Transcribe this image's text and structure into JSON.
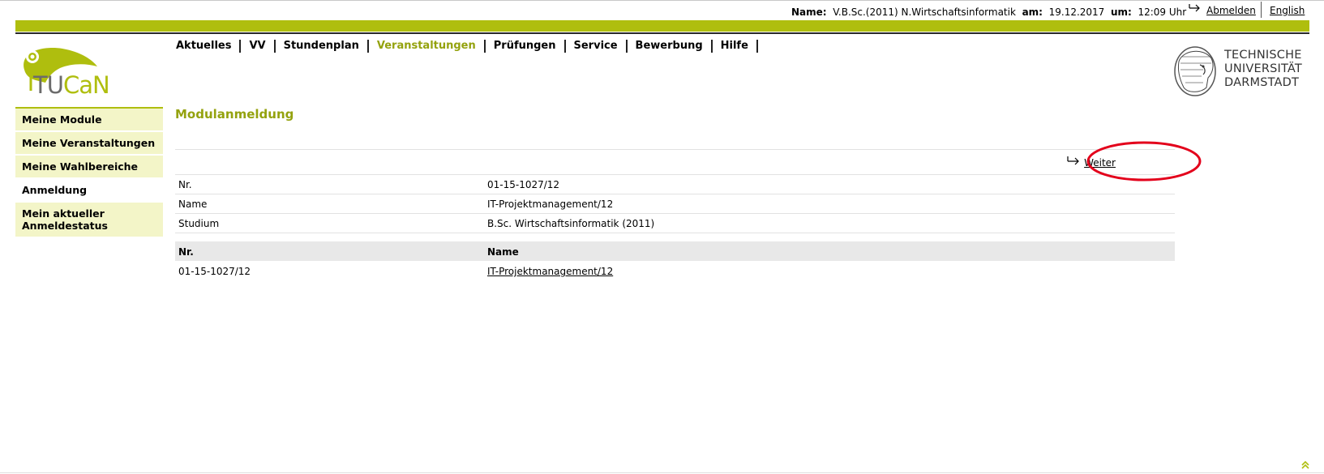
{
  "userbar": {
    "name_label": "Name:",
    "name_value": "V.B.Sc.(2011) N.Wirtschaftsinformatik",
    "date_label": "am:",
    "date_value": "19.12.2017",
    "time_label": "um:",
    "time_value": "12:09 Uhr",
    "logout_label": "Abmelden",
    "language_label": "English"
  },
  "logo": {
    "tu": "TU",
    "can": "CaN"
  },
  "nav": {
    "items": [
      {
        "label": "Aktuelles"
      },
      {
        "label": "VV"
      },
      {
        "label": "Stundenplan"
      },
      {
        "label": "Veranstaltungen"
      },
      {
        "label": "Prüfungen"
      },
      {
        "label": "Service"
      },
      {
        "label": "Bewerbung"
      },
      {
        "label": "Hilfe"
      }
    ],
    "active": "Veranstaltungen"
  },
  "university": {
    "line1": "TECHNISCHE",
    "line2": "UNIVERSITÄT",
    "line3": "DARMSTADT"
  },
  "sidebar": {
    "items": [
      {
        "label": "Meine Module"
      },
      {
        "label": "Meine Veranstaltungen"
      },
      {
        "label": "Meine Wahlbereiche"
      },
      {
        "label": "Anmeldung"
      },
      {
        "label": "Mein aktueller Anmeldestatus"
      }
    ]
  },
  "page": {
    "title": "Modulanmeldung",
    "next_label": "Weiter"
  },
  "details": [
    {
      "label": "Nr.",
      "value": "01-15-1027/12"
    },
    {
      "label": "Name",
      "value": "IT-Projektmanagement/12"
    },
    {
      "label": "Studium",
      "value": "B.Sc. Wirtschaftsinformatik (2011)"
    }
  ],
  "table": {
    "headers": [
      "Nr.",
      "Name"
    ],
    "rows": [
      [
        "01-15-1027/12",
        "IT-Projektmanagement/12"
      ]
    ]
  },
  "colors": {
    "accent": "#afbe0e",
    "accent_text": "#94a20e",
    "highlight_ring": "#e3001b",
    "sidebar_bg": "#f3f5c8"
  }
}
